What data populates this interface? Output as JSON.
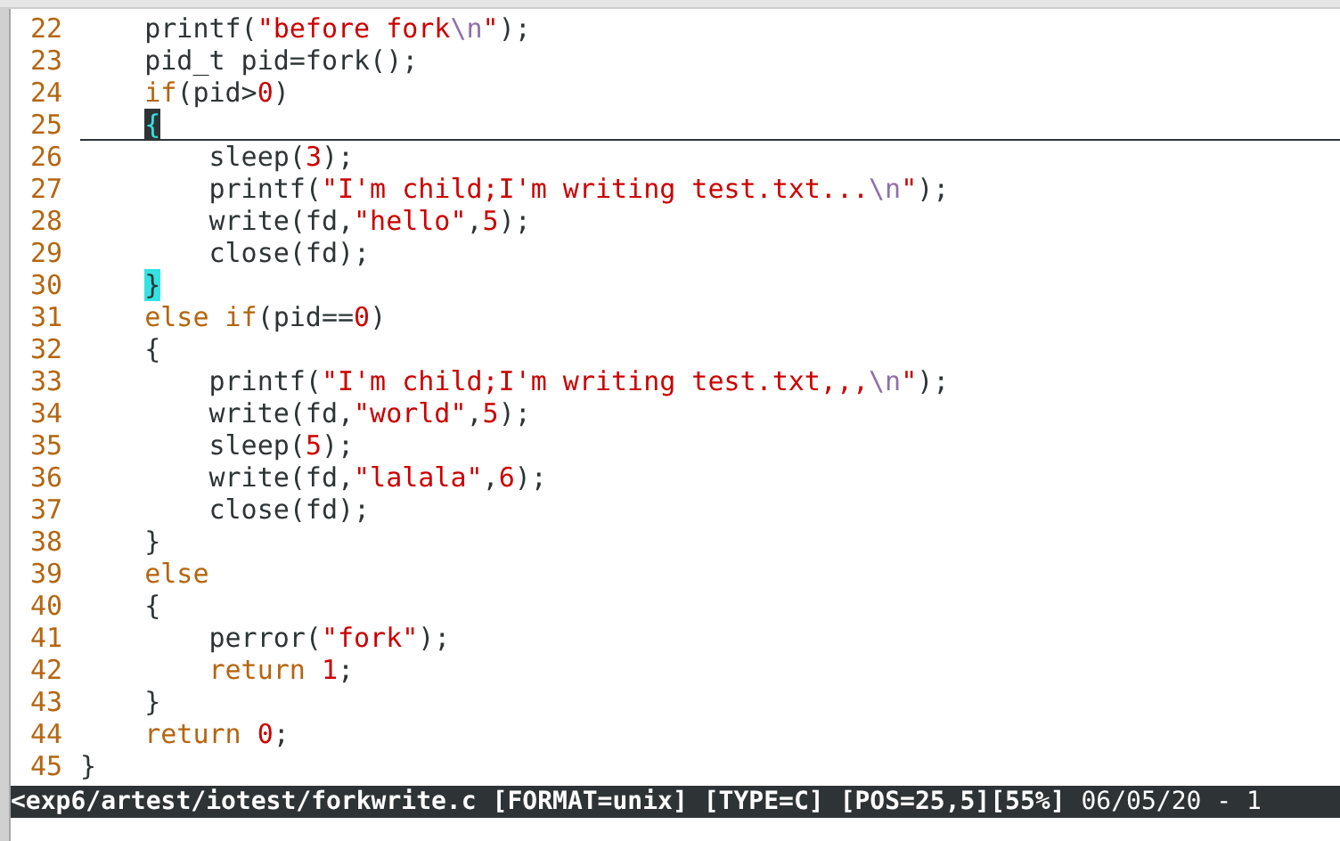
{
  "lines": [
    {
      "number": "22",
      "cursor_line": false,
      "tokens": [
        {
          "kind": "plain",
          "text": "    printf("
        },
        {
          "kind": "string",
          "text": "\"before fork"
        },
        {
          "kind": "escape",
          "text": "\\n"
        },
        {
          "kind": "string",
          "text": "\""
        },
        {
          "kind": "plain",
          "text": ");"
        }
      ]
    },
    {
      "number": "23",
      "cursor_line": false,
      "tokens": [
        {
          "kind": "plain",
          "text": "    pid_t pid=fork();"
        }
      ]
    },
    {
      "number": "24",
      "cursor_line": false,
      "tokens": [
        {
          "kind": "keyword",
          "text": "    if"
        },
        {
          "kind": "plain",
          "text": "(pid>"
        },
        {
          "kind": "number",
          "text": "0"
        },
        {
          "kind": "plain",
          "text": ")"
        }
      ]
    },
    {
      "number": "25",
      "cursor_line": true,
      "tokens": [
        {
          "kind": "cursor",
          "text": "    {"
        }
      ]
    },
    {
      "number": "26",
      "cursor_line": false,
      "tokens": [
        {
          "kind": "plain",
          "text": "        sleep("
        },
        {
          "kind": "number",
          "text": "3"
        },
        {
          "kind": "plain",
          "text": ");"
        }
      ]
    },
    {
      "number": "27",
      "cursor_line": false,
      "tokens": [
        {
          "kind": "plain",
          "text": "        printf("
        },
        {
          "kind": "string",
          "text": "\"I'm child;I'm writing test.txt..."
        },
        {
          "kind": "escape",
          "text": "\\n"
        },
        {
          "kind": "string",
          "text": "\""
        },
        {
          "kind": "plain",
          "text": ");"
        }
      ]
    },
    {
      "number": "28",
      "cursor_line": false,
      "tokens": [
        {
          "kind": "plain",
          "text": "        write(fd,"
        },
        {
          "kind": "string",
          "text": "\"hello\""
        },
        {
          "kind": "plain",
          "text": ","
        },
        {
          "kind": "number",
          "text": "5"
        },
        {
          "kind": "plain",
          "text": ");"
        }
      ]
    },
    {
      "number": "29",
      "cursor_line": false,
      "tokens": [
        {
          "kind": "plain",
          "text": "        close(fd);"
        }
      ]
    },
    {
      "number": "30",
      "cursor_line": false,
      "tokens": [
        {
          "kind": "match",
          "text": "    }"
        }
      ]
    },
    {
      "number": "31",
      "cursor_line": false,
      "tokens": [
        {
          "kind": "keyword",
          "text": "    else if"
        },
        {
          "kind": "plain",
          "text": "(pid=="
        },
        {
          "kind": "number",
          "text": "0"
        },
        {
          "kind": "plain",
          "text": ")"
        }
      ]
    },
    {
      "number": "32",
      "cursor_line": false,
      "tokens": [
        {
          "kind": "plain",
          "text": "    {"
        }
      ]
    },
    {
      "number": "33",
      "cursor_line": false,
      "tokens": [
        {
          "kind": "plain",
          "text": "        printf("
        },
        {
          "kind": "string",
          "text": "\"I'm child;I'm writing test.txt,,,"
        },
        {
          "kind": "escape",
          "text": "\\n"
        },
        {
          "kind": "string",
          "text": "\""
        },
        {
          "kind": "plain",
          "text": ");"
        }
      ]
    },
    {
      "number": "34",
      "cursor_line": false,
      "tokens": [
        {
          "kind": "plain",
          "text": "        write(fd,"
        },
        {
          "kind": "string",
          "text": "\"world\""
        },
        {
          "kind": "plain",
          "text": ","
        },
        {
          "kind": "number",
          "text": "5"
        },
        {
          "kind": "plain",
          "text": ");"
        }
      ]
    },
    {
      "number": "35",
      "cursor_line": false,
      "tokens": [
        {
          "kind": "plain",
          "text": "        sleep("
        },
        {
          "kind": "number",
          "text": "5"
        },
        {
          "kind": "plain",
          "text": ");"
        }
      ]
    },
    {
      "number": "36",
      "cursor_line": false,
      "tokens": [
        {
          "kind": "plain",
          "text": "        write(fd,"
        },
        {
          "kind": "string",
          "text": "\"lalala\""
        },
        {
          "kind": "plain",
          "text": ","
        },
        {
          "kind": "number",
          "text": "6"
        },
        {
          "kind": "plain",
          "text": ");"
        }
      ]
    },
    {
      "number": "37",
      "cursor_line": false,
      "tokens": [
        {
          "kind": "plain",
          "text": "        close(fd);"
        }
      ]
    },
    {
      "number": "38",
      "cursor_line": false,
      "tokens": [
        {
          "kind": "plain",
          "text": "    }"
        }
      ]
    },
    {
      "number": "39",
      "cursor_line": false,
      "tokens": [
        {
          "kind": "keyword",
          "text": "    else"
        }
      ]
    },
    {
      "number": "40",
      "cursor_line": false,
      "tokens": [
        {
          "kind": "plain",
          "text": "    {"
        }
      ]
    },
    {
      "number": "41",
      "cursor_line": false,
      "tokens": [
        {
          "kind": "plain",
          "text": "        perror("
        },
        {
          "kind": "string",
          "text": "\"fork\""
        },
        {
          "kind": "plain",
          "text": ");"
        }
      ]
    },
    {
      "number": "42",
      "cursor_line": false,
      "tokens": [
        {
          "kind": "keyword",
          "text": "        return"
        },
        {
          "kind": "number",
          "text": " 1"
        },
        {
          "kind": "plain",
          "text": ";"
        }
      ]
    },
    {
      "number": "43",
      "cursor_line": false,
      "tokens": [
        {
          "kind": "plain",
          "text": "    }"
        }
      ]
    },
    {
      "number": "44",
      "cursor_line": false,
      "tokens": [
        {
          "kind": "keyword",
          "text": "    return"
        },
        {
          "kind": "number",
          "text": " 0"
        },
        {
          "kind": "plain",
          "text": ";"
        }
      ]
    },
    {
      "number": "45",
      "cursor_line": false,
      "tokens": [
        {
          "kind": "plain",
          "text": "}"
        }
      ]
    }
  ],
  "status_bar": {
    "file": "<exp6/artest/iotest/forkwrite.c",
    "fields": [
      "[FORMAT=unix]",
      "[TYPE=C]",
      "[POS=25,5][55%]"
    ],
    "date": "06/05/20 - 1"
  }
}
